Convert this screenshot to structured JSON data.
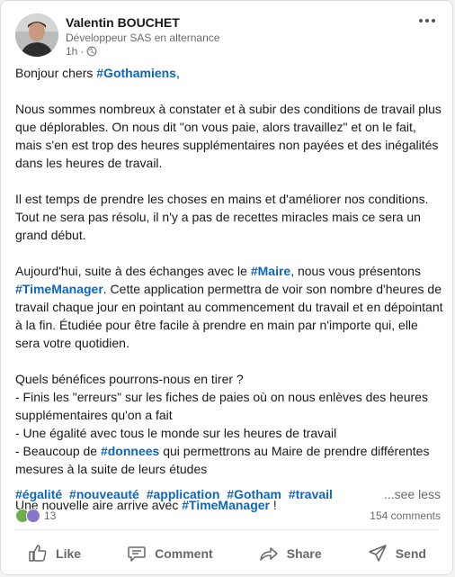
{
  "post": {
    "author": {
      "name": "Valentin BOUCHET",
      "headline": "Développeur SAS en alternance",
      "time": "1h",
      "visibility_icon": "globe-icon"
    },
    "menu_icon": "more-horizontal-icon",
    "body": {
      "greeting_before": "Bonjour chers ",
      "greeting_tag": "#Gothamiens",
      "greeting_after": ",",
      "p1": "Nous sommes nombreux à constater et à subir des conditions de travail plus que déplorables. On nous dit \"on vous paie, alors travaillez\" et on le fait, mais s'en est trop des heures supplémentaires non payées et des inégalités dans les heures de travail.",
      "p2": "Il est temps de prendre les choses en mains et d'améliorer nos conditions. Tout ne sera pas résolu, il n'y a pas de recettes miracles mais ce sera un grand début.",
      "p3_a": "Aujourd'hui, suite à des échanges avec le ",
      "p3_tag1": "#Maire",
      "p3_b": ", nous vous présentons ",
      "p3_tag2": "#TimeManager",
      "p3_c": ". Cette application permettra de voir son nombre d'heures de travail chaque jour en pointant au commencement du travail et en dépointant à la fin. Étudiée pour être facile à prendre en main par n'importe qui, elle sera votre quotidien.",
      "p4_l1": "Quels bénéfices pourrons-nous en tirer ?",
      "p4_l2": "- Finis les \"erreurs\" sur les fiches de paies où on nous enlèves des heures supplémentaires qu'on a fait",
      "p4_l3": "- Une égalité avec tous le monde sur les heures de travail",
      "p4_l4_a": "- Beaucoup de ",
      "p4_l4_tag": "#donnees",
      "p4_l4_b": " qui permettrons au Maire de prendre différentes mesures à la suite de leurs études",
      "p5_a": "Une nouvelle aire arrive avec ",
      "p5_tag": "#TimeManager",
      "p5_b": " !"
    },
    "hashtags": [
      "#égalité",
      "#nouveauté",
      "#application",
      "#Gotham",
      "#travail"
    ],
    "see_less": "...see less",
    "reactions": {
      "count": "13",
      "icons": [
        "celebrate-icon",
        "support-icon"
      ]
    },
    "comments": "154 comments",
    "actions": {
      "like": "Like",
      "comment": "Comment",
      "share": "Share",
      "send": "Send"
    },
    "colors": {
      "link": "#0a66c2",
      "text_muted": "#666666",
      "background": "#f3f2ef"
    }
  }
}
